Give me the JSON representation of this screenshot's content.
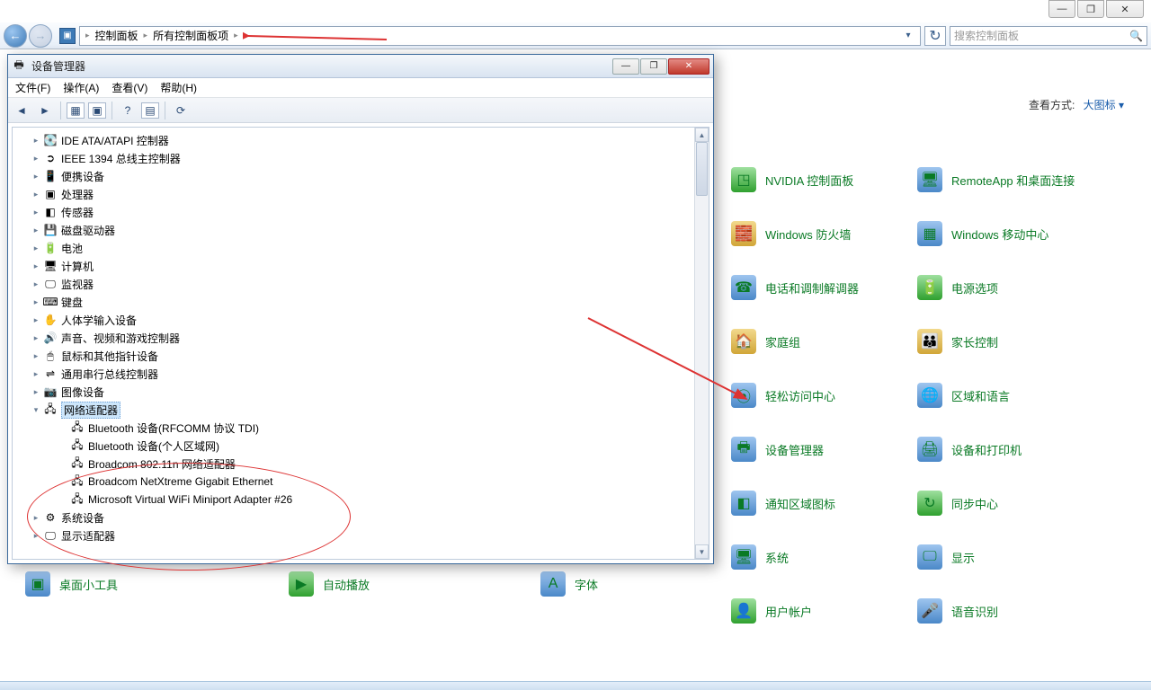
{
  "top_window_buttons": {
    "min": "—",
    "max": "❐",
    "close": "✕"
  },
  "nav": {
    "crumbs": [
      "控制面板",
      "所有控制面板项"
    ],
    "sep": "▸",
    "refresh": "↻",
    "search_placeholder": "搜索控制面板"
  },
  "view_mode": {
    "label": "查看方式:",
    "value": "大图标 ▾"
  },
  "cp_col_a": [
    {
      "label": "NVIDIA 控制面板",
      "ic": "◳",
      "cls": "gic"
    },
    {
      "label": "Windows 防火墙",
      "ic": "🧱",
      "cls": "yic"
    },
    {
      "label": "电话和调制解调器",
      "ic": "☎",
      "cls": "bic"
    },
    {
      "label": "家庭组",
      "ic": "🏠",
      "cls": "yic"
    },
    {
      "label": "轻松访问中心",
      "ic": "⦿",
      "cls": "bic"
    },
    {
      "label": "设备管理器",
      "ic": "🖶",
      "cls": "bic"
    },
    {
      "label": "通知区域图标",
      "ic": "◧",
      "cls": "bic"
    },
    {
      "label": "系统",
      "ic": "🖥",
      "cls": "bic"
    },
    {
      "label": "用户帐户",
      "ic": "👤",
      "cls": "gic"
    }
  ],
  "cp_col_b": [
    {
      "label": "RemoteApp 和桌面连接",
      "ic": "🖥",
      "cls": "bic"
    },
    {
      "label": "Windows 移动中心",
      "ic": "▦",
      "cls": "bic"
    },
    {
      "label": "电源选项",
      "ic": "🔋",
      "cls": "gic"
    },
    {
      "label": "家长控制",
      "ic": "👪",
      "cls": "yic"
    },
    {
      "label": "区域和语言",
      "ic": "🌐",
      "cls": "bic"
    },
    {
      "label": "设备和打印机",
      "ic": "🖨",
      "cls": "bic"
    },
    {
      "label": "同步中心",
      "ic": "↻",
      "cls": "gic"
    },
    {
      "label": "显示",
      "ic": "🖵",
      "cls": "bic"
    },
    {
      "label": "语音识别",
      "ic": "🎤",
      "cls": "bic"
    }
  ],
  "cp_bottom": [
    {
      "label": "桌面小工具",
      "ic": "▣",
      "cls": "bic"
    },
    {
      "label": "自动播放",
      "ic": "▶",
      "cls": "gic"
    },
    {
      "label": "字体",
      "ic": "A",
      "cls": "bic"
    }
  ],
  "devmgr": {
    "title": "设备管理器",
    "menu": [
      "文件(F)",
      "操作(A)",
      "查看(V)",
      "帮助(H)"
    ],
    "toolbar": [
      "◄",
      "►",
      "sep",
      "▦",
      "▣",
      "sep",
      "?",
      "▤",
      "sep",
      "⟳"
    ],
    "win_buttons": {
      "min": "—",
      "max": "❐",
      "close": "✕"
    },
    "tree": [
      {
        "label": "IDE ATA/ATAPI 控制器",
        "ic": "💽"
      },
      {
        "label": "IEEE 1394 总线主控制器",
        "ic": "➲"
      },
      {
        "label": "便携设备",
        "ic": "📱"
      },
      {
        "label": "处理器",
        "ic": "▣"
      },
      {
        "label": "传感器",
        "ic": "◧"
      },
      {
        "label": "磁盘驱动器",
        "ic": "💾"
      },
      {
        "label": "电池",
        "ic": "🔋"
      },
      {
        "label": "计算机",
        "ic": "🖥"
      },
      {
        "label": "监视器",
        "ic": "🖵"
      },
      {
        "label": "键盘",
        "ic": "⌨"
      },
      {
        "label": "人体学输入设备",
        "ic": "✋"
      },
      {
        "label": "声音、视频和游戏控制器",
        "ic": "🔊"
      },
      {
        "label": "鼠标和其他指针设备",
        "ic": "🖱"
      },
      {
        "label": "通用串行总线控制器",
        "ic": "⇌"
      },
      {
        "label": "图像设备",
        "ic": "📷"
      }
    ],
    "net_adapter": {
      "label": "网络适配器",
      "ic": "🖧",
      "children": [
        "Bluetooth 设备(RFCOMM 协议 TDI)",
        "Bluetooth 设备(个人区域网)",
        "Broadcom 802.11n 网络适配器",
        "Broadcom NetXtreme Gigabit Ethernet",
        "Microsoft Virtual WiFi Miniport Adapter #26"
      ]
    },
    "tail": [
      {
        "label": "系统设备",
        "ic": "⚙"
      },
      {
        "label": "显示适配器",
        "ic": "🖵"
      }
    ]
  }
}
